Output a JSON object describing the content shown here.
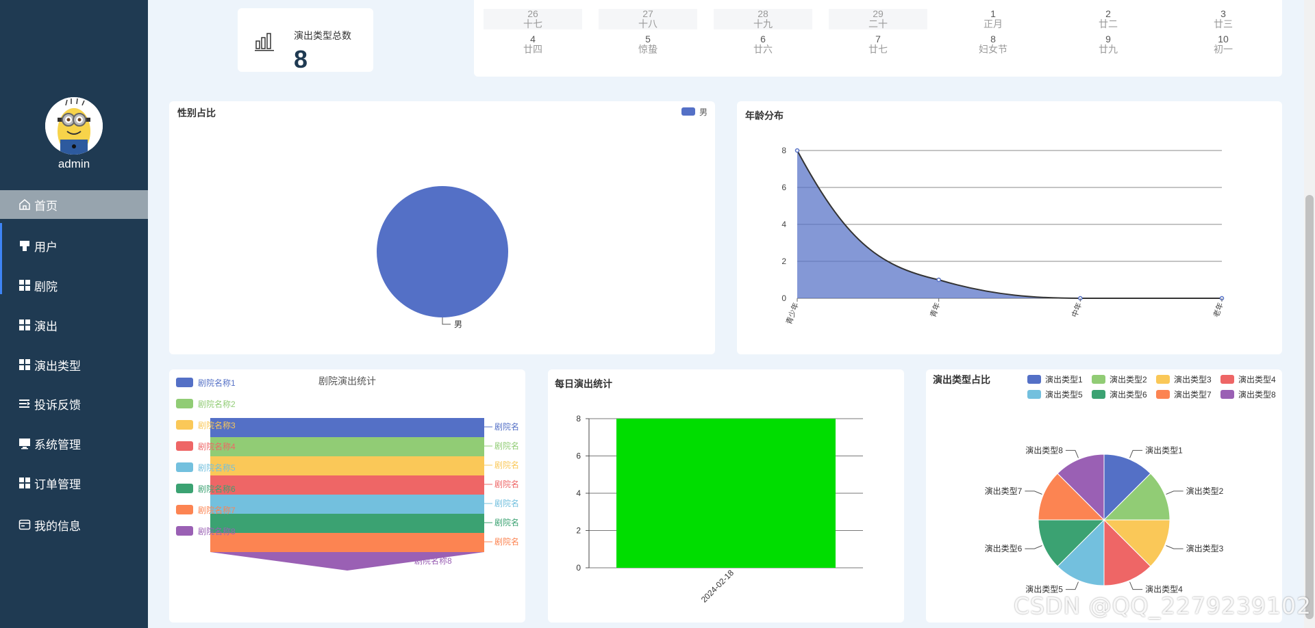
{
  "user": {
    "name": "admin"
  },
  "menu": [
    {
      "label": "首页",
      "icon": "home-icon"
    },
    {
      "label": "用户",
      "icon": "user-icon"
    },
    {
      "label": "剧院",
      "icon": "grid-icon"
    },
    {
      "label": "演出",
      "icon": "grid-icon"
    },
    {
      "label": "演出类型",
      "icon": "grid-icon"
    },
    {
      "label": "投诉反馈",
      "icon": "list-icon"
    },
    {
      "label": "系统管理",
      "icon": "monitor-icon"
    },
    {
      "label": "订单管理",
      "icon": "grid-icon"
    },
    {
      "label": "我的信息",
      "icon": "card-icon"
    }
  ],
  "stat": {
    "label": "演出类型总数",
    "value": "8",
    "icon": "bar-chart-icon"
  },
  "calendar": {
    "rows": [
      [
        {
          "day": "26",
          "sub": "十七",
          "dim": true
        },
        {
          "day": "27",
          "sub": "十八",
          "dim": true
        },
        {
          "day": "28",
          "sub": "十九",
          "dim": true
        },
        {
          "day": "29",
          "sub": "二十",
          "dim": true
        },
        {
          "day": "1",
          "sub": "正月",
          "dim": false
        },
        {
          "day": "2",
          "sub": "廿二",
          "dim": false
        },
        {
          "day": "3",
          "sub": "廿三",
          "dim": false
        }
      ],
      [
        {
          "day": "4",
          "sub": "廿四",
          "dim": false
        },
        {
          "day": "5",
          "sub": "惊蛰",
          "dim": false
        },
        {
          "day": "6",
          "sub": "廿六",
          "dim": false
        },
        {
          "day": "7",
          "sub": "廿七",
          "dim": false
        },
        {
          "day": "8",
          "sub": "妇女节",
          "dim": false
        },
        {
          "day": "9",
          "sub": "廿九",
          "dim": false
        },
        {
          "day": "10",
          "sub": "初一",
          "dim": false
        }
      ]
    ]
  },
  "colors": {
    "sidebar": "#1f3a52",
    "palette": [
      "#5470c6",
      "#91cc75",
      "#fac858",
      "#ee6666",
      "#73c0de",
      "#3ba272",
      "#fc8452",
      "#9a60b4"
    ],
    "daily_bar": "#00dd00"
  },
  "watermark": "CSDN @QQ_2279239102",
  "chart_data": [
    {
      "type": "pie",
      "title": "性别占比",
      "legend": [
        "男"
      ],
      "legend_position": "top-right",
      "slices": [
        {
          "name": "男",
          "value": 1
        }
      ]
    },
    {
      "type": "area",
      "title": "年龄分布",
      "categories": [
        "青少年",
        "青年",
        "中年",
        "老年"
      ],
      "values": [
        8,
        1,
        0,
        0
      ],
      "ylim": [
        0,
        8
      ],
      "yticks": [
        "0",
        "2",
        "4",
        "6",
        "8"
      ],
      "smooth": true,
      "grid": true
    },
    {
      "type": "funnel",
      "title": "剧院演出统计",
      "legend": [
        "剧院名称1",
        "剧院名称2",
        "剧院名称3",
        "剧院名称4",
        "剧院名称5",
        "剧院名称6",
        "剧院名称7",
        "剧院名称8"
      ],
      "legend_position": "top-left",
      "values": [
        1,
        1,
        1,
        1,
        1,
        1,
        1,
        0
      ],
      "labels": [
        "剧院名",
        "剧院名",
        "剧院名",
        "剧院名",
        "剧院名",
        "剧院名",
        "剧院名",
        "剧院名称8"
      ]
    },
    {
      "type": "bar",
      "title": "每日演出统计",
      "categories": [
        "2024-02-18"
      ],
      "values": [
        8
      ],
      "ylim": [
        0,
        8
      ],
      "yticks": [
        "0",
        "2",
        "4",
        "6",
        "8"
      ],
      "grid": true
    },
    {
      "type": "pie",
      "title": "演出类型占比",
      "legend_position": "top-right",
      "slices": [
        {
          "name": "演出类型1",
          "value": 1
        },
        {
          "name": "演出类型2",
          "value": 1
        },
        {
          "name": "演出类型3",
          "value": 1
        },
        {
          "name": "演出类型4",
          "value": 1
        },
        {
          "name": "演出类型5",
          "value": 1
        },
        {
          "name": "演出类型6",
          "value": 1
        },
        {
          "name": "演出类型7",
          "value": 1
        },
        {
          "name": "演出类型8",
          "value": 1
        }
      ]
    }
  ]
}
